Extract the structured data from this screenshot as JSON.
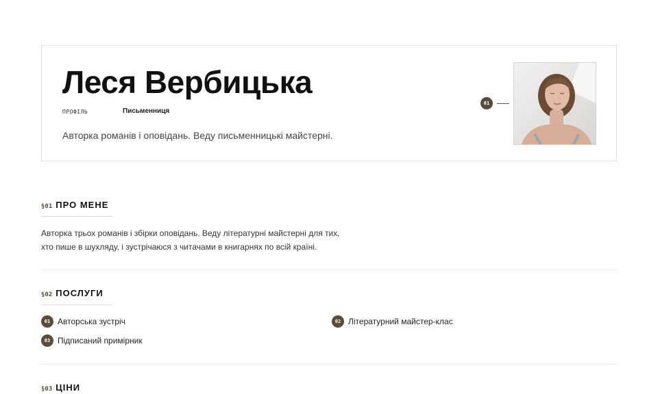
{
  "profile": {
    "name": "Леся Вербицька",
    "meta_label": "ПРОФІЛЬ",
    "meta_value": "Письменниця",
    "tagline": "Авторка романів і оповідань. Веду письменницькі майстерні.",
    "photo_marker": "01"
  },
  "sections": {
    "about": {
      "num": "§01",
      "title": "ПРО МЕНЕ",
      "line1": "Авторка трьох романів і збірки оповідань. Веду літературні майстерні для тих,",
      "line2": "хто пише в шухляду, і зустрічаюся з читачами в книгарнях по всій країні."
    },
    "services": {
      "num": "§02",
      "title": "ПОСЛУГИ",
      "items": [
        {
          "num": "01",
          "label": "Авторська зустріч"
        },
        {
          "num": "02",
          "label": "Літературний майстер-клас"
        },
        {
          "num": "03",
          "label": "Підписаний примірник"
        }
      ]
    },
    "prices": {
      "num": "§03",
      "title": "ЦІНИ"
    }
  },
  "colors": {
    "accent": "#5a4c39",
    "border": "#e6e3da"
  }
}
